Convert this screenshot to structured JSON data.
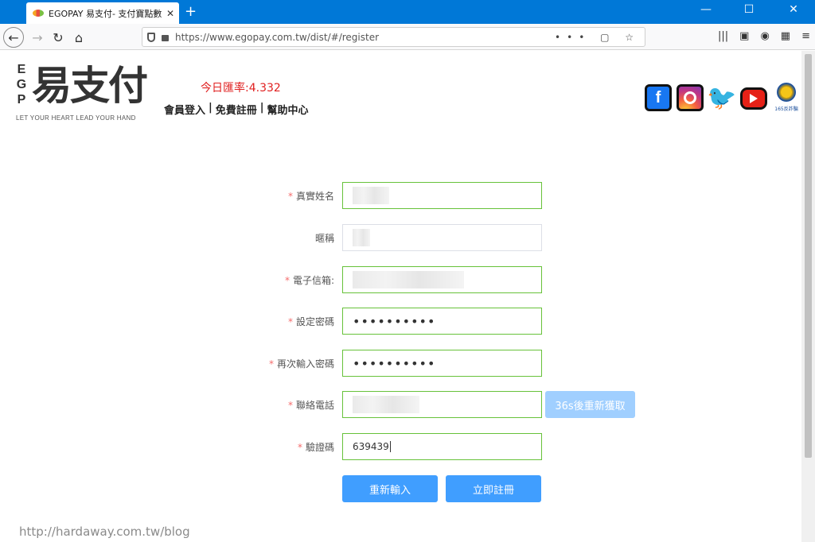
{
  "browser": {
    "tab_title": "EGOPAY 易支付- 支付寶點數代",
    "tab_close": "✕",
    "new_tab": "+",
    "url": "https://www.egopay.com.tw/dist/#/register",
    "url_actions": "••• ▢ ☆",
    "win_min": "—",
    "win_max": "☐",
    "win_close": "✕"
  },
  "header": {
    "logo_letters": "E G P",
    "logo_text": "易支付",
    "slogan": "LET YOUR HEART LEAD YOUR HAND",
    "exchange_rate": "今日匯率:4.332",
    "nav": {
      "login": "會員登入",
      "sep1": "|",
      "register": "免費註冊",
      "sep2": "|",
      "help": "幫助中心"
    },
    "social": {
      "facebook": "f",
      "twitter": "🐦",
      "badge_text": "165反詐騙"
    }
  },
  "form": {
    "required_mark": "*",
    "fields": [
      {
        "label": "真實姓名",
        "required": true,
        "value": ""
      },
      {
        "label": "暱稱",
        "required": false,
        "value": ""
      },
      {
        "label": "電子信箱:",
        "required": true,
        "value": ""
      },
      {
        "label": "設定密碼",
        "required": true,
        "value": "••••••••••"
      },
      {
        "label": "再次輸入密碼",
        "required": true,
        "value": "••••••••••"
      },
      {
        "label": "聯絡電話",
        "required": true,
        "value": ""
      },
      {
        "label": "驗證碼",
        "required": true,
        "value": "639439"
      }
    ],
    "sms_button": "36s後重新獲取",
    "reset_button": "重新輸入",
    "submit_button": "立即註冊"
  },
  "watermark": "http://hardaway.com.tw/blog",
  "colors": {
    "titlebar": "#0078d7",
    "input_border_valid": "#67c23a",
    "primary_button": "#409eff",
    "disabled_button": "#a0cfff",
    "rate_text": "#e02020"
  }
}
